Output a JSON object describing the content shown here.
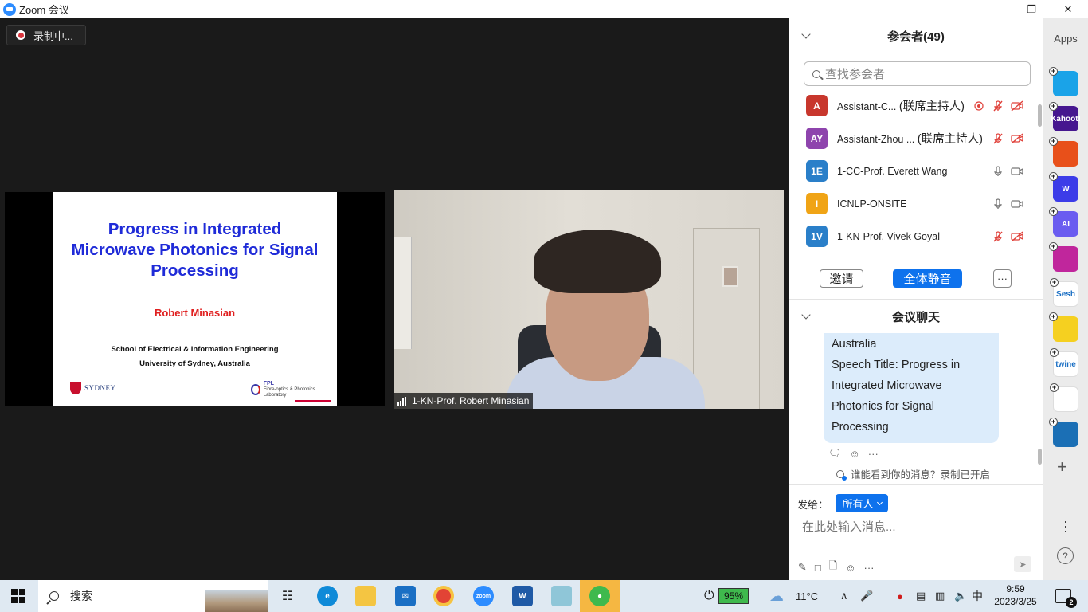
{
  "window": {
    "title": "Zoom 会议",
    "minimize": "—",
    "restore": "❐",
    "close": "✕"
  },
  "meeting": {
    "recording_label": "录制中...",
    "slide": {
      "title_lines": [
        "Progress in Integrated",
        "Microwave Photonics for Signal",
        "Processing"
      ],
      "author": "Robert Minasian",
      "school": "School of Electrical & Information Engineering",
      "university": "University of Sydney, Australia",
      "logo_left": "SYDNEY",
      "logo_right_title": "FPL",
      "logo_right_sub": "Fibre-optics & Photonics Laboratory"
    },
    "video_name": "1-KN-Prof. Robert Minasian"
  },
  "participants": {
    "header": "参会者(49)",
    "search_placeholder": "查找参会者",
    "rows": [
      {
        "initials": "A",
        "color": "#c8372d",
        "name": "Assistant-C...",
        "role": "(联席主持人)",
        "muted": true,
        "video_off": true,
        "recording": true
      },
      {
        "initials": "AY",
        "color": "#8e44ad",
        "name": "Assistant-Zhou ...",
        "role": "(联席主持人)",
        "muted": true,
        "video_off": true,
        "recording": false
      },
      {
        "initials": "1E",
        "color": "#2a7fc9",
        "name": "1-CC-Prof. Everett Wang",
        "role": "",
        "muted": false,
        "video_off": false,
        "recording": false
      },
      {
        "initials": "I",
        "color": "#f0a416",
        "name": "ICNLP-ONSITE",
        "role": "",
        "muted": false,
        "video_off": false,
        "recording": false
      },
      {
        "initials": "1V",
        "color": "#2a7fc9",
        "name": "1-KN-Prof. Vivek Goyal",
        "role": "",
        "muted": true,
        "video_off": true,
        "recording": false
      }
    ],
    "invite_label": "邀请",
    "mute_all_label": "全体静音",
    "more_label": "···"
  },
  "chat": {
    "header": "会议聊天",
    "message_lines": [
      "Australia",
      "Speech Title: Progress in",
      "Integrated Microwave",
      "Photonics for Signal",
      "Processing"
    ],
    "visibility_note": "谁能看到你的消息？录制已开启",
    "send_to_label": "发给：",
    "recipient": "所有人",
    "input_placeholder": "在此处输入消息..."
  },
  "apps_rail": {
    "label": "Apps",
    "apps": [
      {
        "name": "app-1",
        "text": "",
        "color": "#1aa3e8"
      },
      {
        "name": "kahoot",
        "text": "Kahoot!",
        "color": "#46178f"
      },
      {
        "name": "app-3",
        "text": "",
        "color": "#e8501a"
      },
      {
        "name": "wooclap",
        "text": "W",
        "color": "#3c3ce8"
      },
      {
        "name": "ai-app",
        "text": "AI",
        "color": "#6a5cf0"
      },
      {
        "name": "app-6",
        "text": "",
        "color": "#c0269c"
      },
      {
        "name": "sesh",
        "text": "Sesh",
        "color": "#ffffff"
      },
      {
        "name": "app-8",
        "text": "",
        "color": "#f5d020"
      },
      {
        "name": "twine",
        "text": "twine",
        "color": "#ffffff"
      },
      {
        "name": "app-10",
        "text": "",
        "color": "#ffffff"
      },
      {
        "name": "app-11",
        "text": "",
        "color": "#1b6fb5"
      }
    ]
  },
  "taskbar": {
    "search_label": "搜索",
    "battery": "95%",
    "weather": "11°C",
    "ime": "中",
    "time": "9:59",
    "date": "2023/3/25",
    "notifications": "2"
  }
}
